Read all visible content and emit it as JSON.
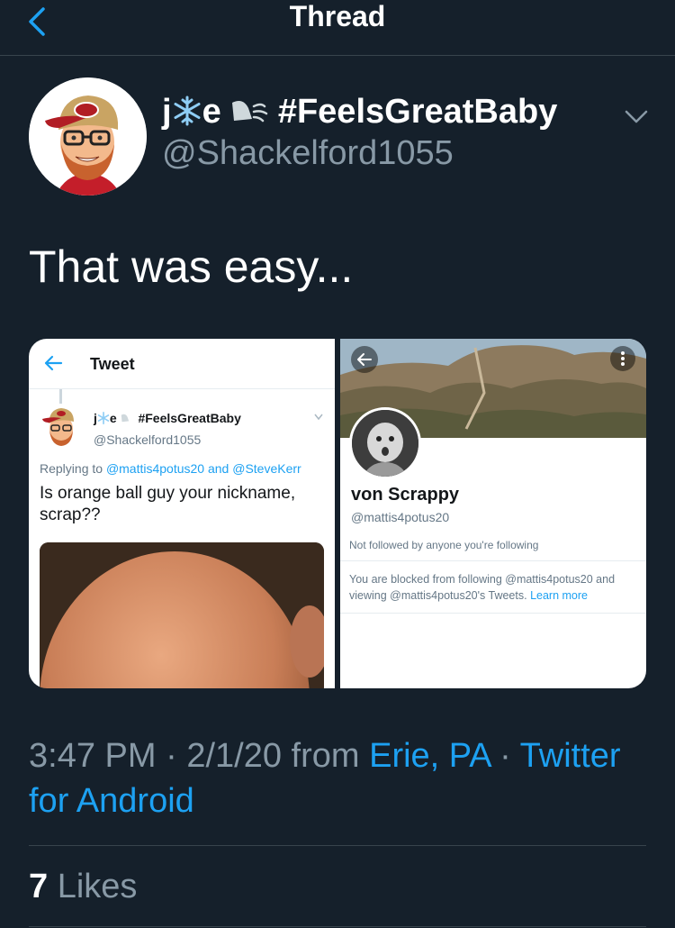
{
  "header": {
    "title": "Thread"
  },
  "tweet": {
    "author": {
      "display_name_prefix": "j",
      "display_name_mid": "e",
      "display_name_hashtag": "#FeelsGreatBaby",
      "handle": "@Shackelford1055"
    },
    "text": "That was easy...",
    "meta": {
      "time": "3:47 PM",
      "sep1": " · ",
      "date": "2/1/20",
      "from": " from ",
      "location": "Erie, PA",
      "sep2": " · ",
      "source": "Twitter for Android"
    },
    "likes": {
      "count": "7",
      "label": "Likes"
    }
  },
  "media_left": {
    "header_title": "Tweet",
    "name_prefix": "j",
    "name_mid": "e",
    "name_hashtag": "#FeelsGreatBaby",
    "handle": "@Shackelford1055",
    "replying_to": "Replying to",
    "mention1": "@mattis4potus20",
    "and": "and",
    "mention2": "@SteveKerr",
    "body": "Is orange ball guy your nickname, scrap??"
  },
  "media_right": {
    "name": "von Scrappy",
    "handle": "@mattis4potus20",
    "followed_note": "Not followed by anyone you're following",
    "blocked_text": "You are blocked from following @mattis4potus20 and viewing @mattis4potus20's Tweets.",
    "learn_more": "Learn more"
  },
  "colors": {
    "background": "#15202b",
    "accent": "#1da1f2",
    "muted": "#8899a6",
    "border": "#38444d"
  },
  "icons": [
    "back-arrow-icon",
    "chevron-down-icon",
    "snowflake-icon",
    "wind-icon",
    "more-icon"
  ]
}
